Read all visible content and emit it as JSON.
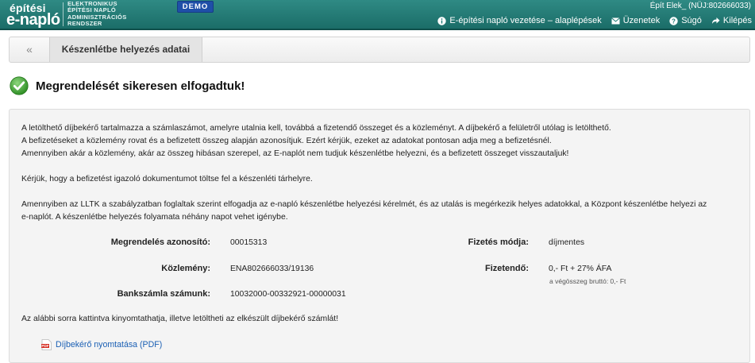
{
  "header": {
    "logo_line1": "építési",
    "logo_line2": "e-napló",
    "system_name": [
      "ELEKTRONIKUS",
      "ÉPÍTÉSI NAPLÓ",
      "ADMINISZTRÁCIÓS",
      "RENDSZER"
    ],
    "demo_badge": "DEMO",
    "user": "Épít Elek_ (NÜJ:802666033)",
    "nav": [
      {
        "label": "E-építési napló vezetése – alaplépések",
        "icon": "info-icon"
      },
      {
        "label": "Üzenetek",
        "icon": "envelope-icon"
      },
      {
        "label": "Súgó",
        "icon": "question-icon"
      },
      {
        "label": "Kilépés",
        "icon": "logout-arrow-icon"
      }
    ]
  },
  "breadcrumb": {
    "back": "«",
    "current": "Készenlétbe helyezés adatai"
  },
  "success_message": "Megrendelését sikeresen elfogadtuk!",
  "info": {
    "p1_l1": "A letölthető díjbekérő tartalmazza a számlaszámot, amelyre utalnia kell, továbbá a fizetendő összeget és a közleményt. A díjbekérő a felületről utólag is letölthető.",
    "p1_l2": "A befizetéseket a közlemény rovat és a befizetett összeg alapján azonosítjuk. Ezért kérjük, ezeket az adatokat pontosan adja meg a befizetésnél.",
    "p1_l3": "Amennyiben akár a közlemény, akár az összeg hibásan szerepel, az E-naplót nem tudjuk készenlétbe helyezni, és a befizetett összeget visszautaljuk!",
    "p2": "Kérjük, hogy a befizetést igazoló dokumentumot töltse fel a készenléti tárhelyre.",
    "p3_l1": "Amennyiben az LLTK a szabályzatban foglaltak szerint elfogadja az e-napló készenlétbe helyezési kérelmét, és az utalás is megérkezik helyes adatokkal, a Központ készenlétbe helyezi az",
    "p3_l2": "e-naplót. A készenlétbe helyezés folyamata néhány napot vehet igénybe."
  },
  "details": {
    "order_id_label": "Megrendelés azonosító:",
    "order_id": "00015313",
    "reference_label": "Közlemény:",
    "reference": "ENA802666033/19136",
    "account_label": "Bankszámla számunk:",
    "account": "10032000-00332921-00000031",
    "payment_method_label": "Fizetés módja:",
    "payment_method": "díjmentes",
    "amount_label": "Fizetendő:",
    "amount": "0,- Ft + 27% ÁFA",
    "amount_gross": "a végösszeg bruttó: 0,- Ft"
  },
  "download_hint": "Az alábbi sorra kattintva kinyomtathatja, illetve letöltheti az elkészült díjbekérő számlát!",
  "pdf_link": "Díjbekérő nyomtatása (PDF)",
  "pdf_icon_text": "PDF",
  "colors": {
    "header": "#1f7a75",
    "demo": "#1f4fa8",
    "success": "#3aa231",
    "link": "#1a5fb4",
    "pdf": "#d42a1f"
  }
}
